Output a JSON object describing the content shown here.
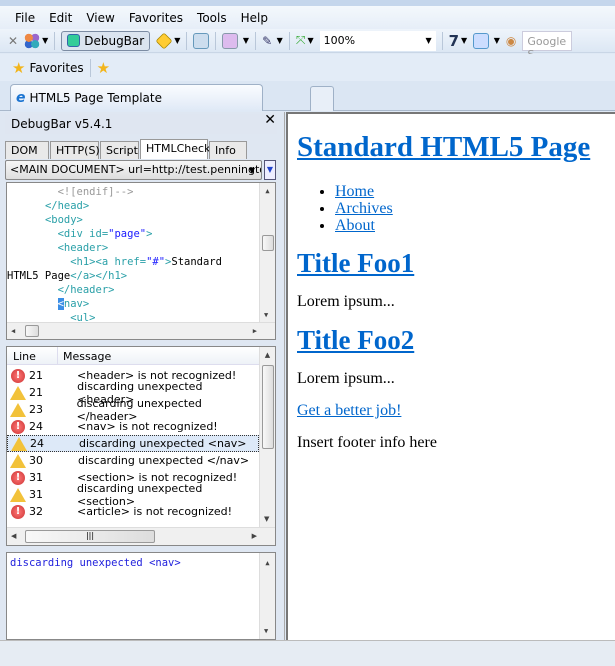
{
  "menubar": {
    "items": [
      "File",
      "Edit",
      "View",
      "Favorites",
      "Tools",
      "Help"
    ]
  },
  "toolbar": {
    "debugbar_label": "DebugBar",
    "zoom_value": "100%",
    "search_placeholder": "Google S"
  },
  "favorites": {
    "label": "Favorites"
  },
  "tabs": [
    {
      "title": "HTML5 Page Template"
    }
  ],
  "debugbar": {
    "title": "DebugBar v5.4.1",
    "tabs": [
      "DOM",
      "HTTP(S)",
      "Script",
      "HTMLCheck",
      "Info"
    ],
    "active_tab": "HTMLCheck",
    "document_select": "<MAIN DOCUMENT> url=http://test.pennington.",
    "code_lines": [
      {
        "indent": "        ",
        "parts": [
          [
            "cmt",
            "<![endif]-->"
          ]
        ]
      },
      {
        "indent": "      ",
        "parts": [
          [
            "tag",
            "</head>"
          ]
        ]
      },
      {
        "indent": "      ",
        "parts": [
          [
            "tag",
            "<body>"
          ]
        ]
      },
      {
        "indent": "        ",
        "parts": [
          [
            "tag",
            "<div id="
          ],
          [
            "val",
            "\"page\""
          ],
          [
            "tag",
            ">"
          ]
        ]
      },
      {
        "indent": "        ",
        "parts": [
          [
            "tag",
            "<header>"
          ]
        ]
      },
      {
        "indent": "          ",
        "parts": [
          [
            "tag",
            "<h1><a href="
          ],
          [
            "val",
            "\"#\""
          ],
          [
            "tag",
            ">"
          ],
          [
            "txt",
            "Standard"
          ]
        ]
      },
      {
        "indent": "",
        "parts": [
          [
            "txt",
            "HTML5 Page"
          ],
          [
            "tag",
            "</a></h1>"
          ]
        ]
      },
      {
        "indent": "        ",
        "parts": [
          [
            "tag",
            "</header>"
          ]
        ]
      },
      {
        "indent": "        ",
        "parts": [
          [
            "sel",
            "<"
          ],
          [
            "tag",
            "nav>"
          ]
        ]
      },
      {
        "indent": "          ",
        "parts": [
          [
            "tag",
            "<ul>"
          ]
        ]
      }
    ],
    "list_headers": {
      "line": "Line",
      "message": "Message"
    },
    "messages": [
      {
        "type": "error",
        "line": "21",
        "message": "<header> is not recognized!"
      },
      {
        "type": "warning",
        "line": "21",
        "message": "discarding unexpected <header>"
      },
      {
        "type": "warning",
        "line": "23",
        "message": "discarding unexpected </header>"
      },
      {
        "type": "error",
        "line": "24",
        "message": "<nav> is not recognized!"
      },
      {
        "type": "warning",
        "line": "24",
        "message": "discarding unexpected <nav>",
        "selected": true
      },
      {
        "type": "warning",
        "line": "30",
        "message": "discarding unexpected </nav>"
      },
      {
        "type": "error",
        "line": "31",
        "message": "<section> is not recognized!"
      },
      {
        "type": "warning",
        "line": "31",
        "message": "discarding unexpected <section>"
      },
      {
        "type": "error",
        "line": "32",
        "message": "<article> is not recognized!"
      }
    ],
    "detail": "discarding unexpected <nav>"
  },
  "page": {
    "h1": "Standard HTML5 Page",
    "nav": [
      "Home",
      "Archives",
      "About"
    ],
    "sections": [
      {
        "title": "Title Foo1",
        "text": "Lorem ipsum..."
      },
      {
        "title": "Title Foo2",
        "text": "Lorem ipsum..."
      }
    ],
    "link": "Get a better job!",
    "footer": "Insert footer info here"
  },
  "colors": {
    "link": "#0066cc",
    "error": "#d83a3a",
    "warning": "#f2c23a",
    "tag": "#2aa0a8"
  }
}
